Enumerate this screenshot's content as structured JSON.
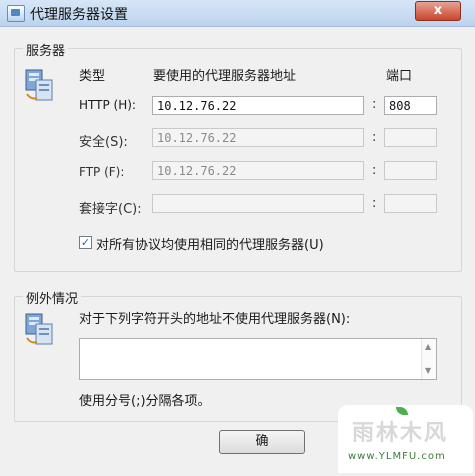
{
  "window": {
    "title": "代理服务器设置",
    "close_label": "x"
  },
  "servers": {
    "group_label": "服务器",
    "col_type": "类型",
    "col_address": "要使用的代理服务器地址",
    "col_port": "端口",
    "rows": [
      {
        "label": "HTTP (H):",
        "address": "10.12.76.22",
        "port": "808",
        "enabled": true
      },
      {
        "label": "安全(S):",
        "address": "10.12.76.22",
        "port": "",
        "enabled": false
      },
      {
        "label": "FTP (F):",
        "address": "10.12.76.22",
        "port": "",
        "enabled": false
      },
      {
        "label": "套接字(C):",
        "address": "",
        "port": "",
        "enabled": false
      }
    ],
    "same_proxy_label": "对所有协议均使用相同的代理服务器(U)",
    "same_proxy_checked": true
  },
  "exceptions": {
    "group_label": "例外情况",
    "description": "对于下列字符开头的地址不使用代理服务器(N):",
    "value": "",
    "hint": "使用分号(;)分隔各项。"
  },
  "buttons": {
    "ok_label": "确"
  },
  "watermark": {
    "name": "雨林木风",
    "url": "www.YLMFU.com"
  },
  "icons": {
    "server": "server-icon",
    "exceptions": "exceptions-icon"
  }
}
